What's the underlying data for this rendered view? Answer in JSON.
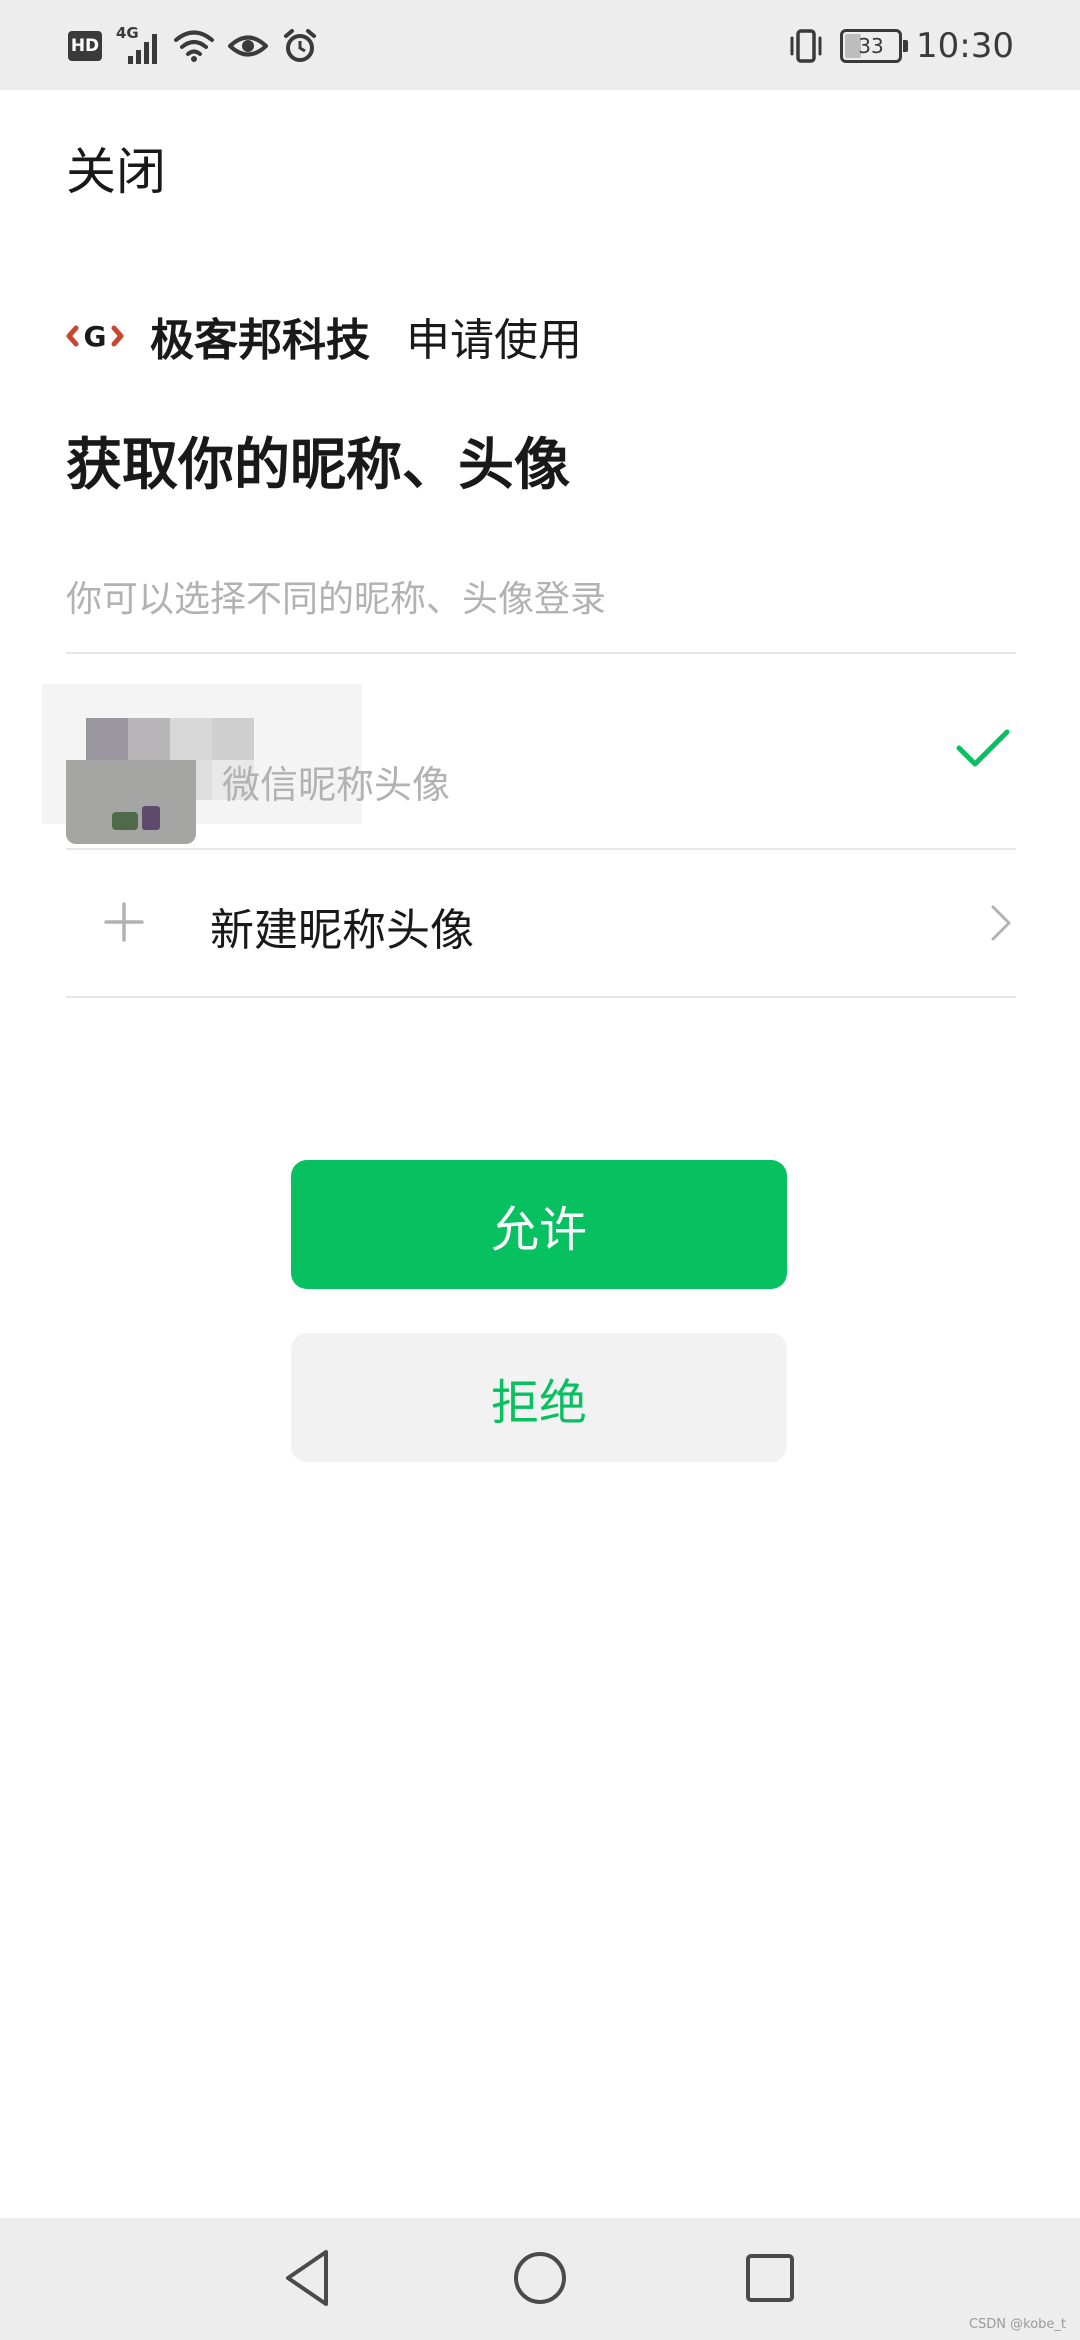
{
  "status_bar": {
    "hd_label": "HD",
    "network_label": "4G",
    "battery_level": "33",
    "time": "10:30",
    "icons": [
      "hd-icon",
      "signal-icon",
      "wifi-icon",
      "eye-icon",
      "alarm-icon",
      "vibrate-icon",
      "battery-icon"
    ]
  },
  "header": {
    "close_label": "关闭"
  },
  "app": {
    "logo_text": "G",
    "name": "极客邦科技",
    "apply_text": "申请使用"
  },
  "title": "获取你的昵称、头像",
  "subtitle": "你可以选择不同的昵称、头像登录",
  "options": {
    "wechat": {
      "label": "微信昵称头像",
      "selected": true
    },
    "new": {
      "label": "新建昵称头像"
    }
  },
  "buttons": {
    "allow": "允许",
    "deny": "拒绝"
  },
  "nav": {
    "icons": [
      "back-icon",
      "home-icon",
      "recent-apps-icon"
    ]
  },
  "watermark": "CSDN @kobe_t",
  "colors": {
    "primary_green": "#07c160",
    "statusbar_bg": "#ededed",
    "hint_gray": "#b2b2b2",
    "deny_bg": "#f2f2f2"
  }
}
